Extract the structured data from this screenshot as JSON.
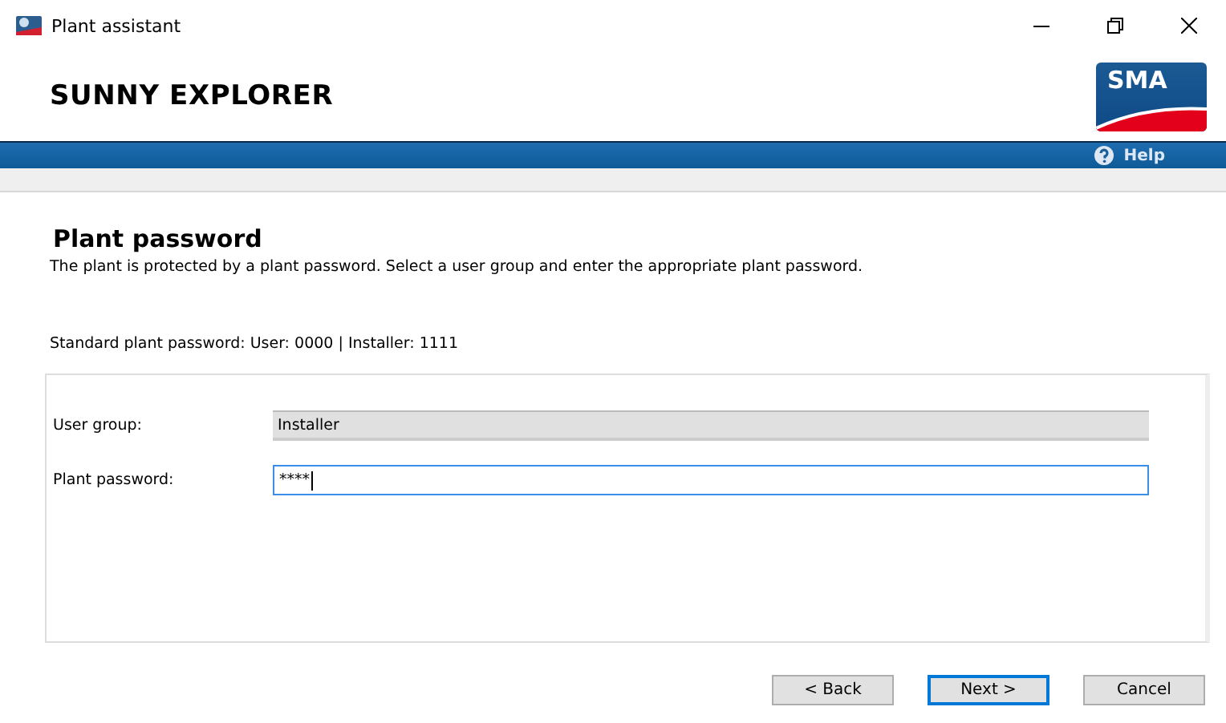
{
  "window": {
    "title": "Plant assistant"
  },
  "header": {
    "product": "SUNNY EXPLORER",
    "logo": "SMA",
    "help": "Help"
  },
  "page": {
    "title": "Plant password",
    "description": "The plant is protected by a plant password. Select a user group and enter the appropriate plant password.",
    "hint": "Standard plant password: User: 0000 | Installer: 1111"
  },
  "fields": [
    {
      "label": "User group:",
      "kind": "select",
      "value": "Installer",
      "focused": false
    },
    {
      "label": "Plant password:",
      "kind": "password",
      "value": "****",
      "focused": true
    }
  ],
  "buttons": [
    {
      "label": "< Back",
      "default": false
    },
    {
      "label": "Next >",
      "default": true
    },
    {
      "label": "Cancel",
      "default": false
    }
  ]
}
